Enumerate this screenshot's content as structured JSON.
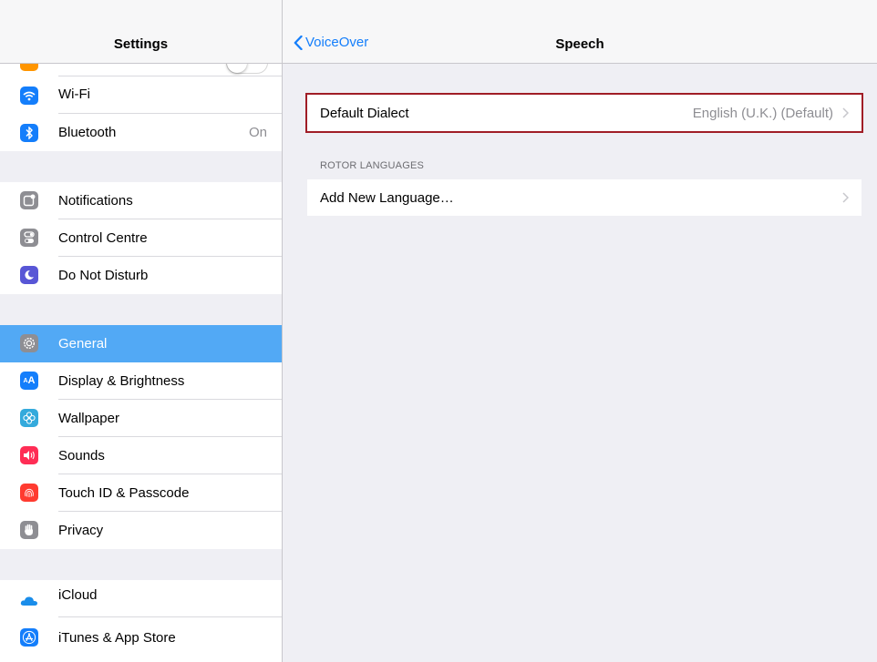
{
  "sidebar": {
    "title": "Settings",
    "items": [
      {
        "id": "wifi",
        "label": "Wi-Fi",
        "value": ""
      },
      {
        "id": "bluetooth",
        "label": "Bluetooth",
        "value": "On"
      },
      {
        "id": "notifications",
        "label": "Notifications",
        "value": ""
      },
      {
        "id": "control-centre",
        "label": "Control Centre",
        "value": ""
      },
      {
        "id": "do-not-disturb",
        "label": "Do Not Disturb",
        "value": ""
      },
      {
        "id": "general",
        "label": "General",
        "value": "",
        "selected": true
      },
      {
        "id": "display",
        "label": "Display & Brightness",
        "value": ""
      },
      {
        "id": "wallpaper",
        "label": "Wallpaper",
        "value": ""
      },
      {
        "id": "sounds",
        "label": "Sounds",
        "value": ""
      },
      {
        "id": "touch-id",
        "label": "Touch ID & Passcode",
        "value": ""
      },
      {
        "id": "privacy",
        "label": "Privacy",
        "value": ""
      },
      {
        "id": "icloud",
        "label": "iCloud",
        "value": ""
      },
      {
        "id": "itunes",
        "label": "iTunes & App Store",
        "value": ""
      }
    ]
  },
  "detail": {
    "back_label": "VoiceOver",
    "title": "Speech",
    "default_dialect": {
      "label": "Default Dialect",
      "value": "English (U.K.) (Default)"
    },
    "rotor_header": "ROTOR LANGUAGES",
    "add_language": {
      "label": "Add New Language…"
    }
  },
  "colors": {
    "accent": "#147efb",
    "selected_row": "#52a9f5",
    "highlight_border": "#a01d26",
    "background": "#efeff4"
  },
  "icons": {
    "wifi": "wifi-icon",
    "bluetooth": "bluetooth-icon",
    "notifications": "notifications-icon",
    "control-centre": "control-centre-icon",
    "do-not-disturb": "moon-icon",
    "general": "gear-icon",
    "display": "display-brightness-icon",
    "wallpaper": "wallpaper-flower-icon",
    "sounds": "speaker-icon",
    "touch-id": "fingerprint-icon",
    "privacy": "hand-icon",
    "icloud": "cloud-icon",
    "itunes": "app-store-icon"
  }
}
